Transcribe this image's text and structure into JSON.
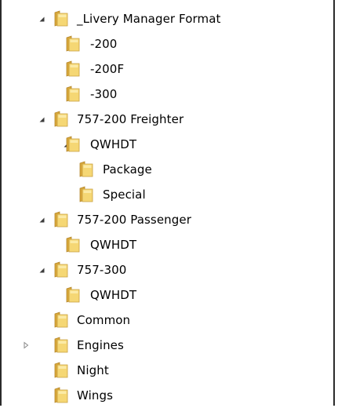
{
  "tree": {
    "items": [
      {
        "label": "_Livery Manager Format",
        "level": 0,
        "expander": "expanded"
      },
      {
        "label": "-200",
        "level": 1,
        "expander": "none"
      },
      {
        "label": "-200F",
        "level": 1,
        "expander": "none"
      },
      {
        "label": "-300",
        "level": 1,
        "expander": "none"
      },
      {
        "label": "757-200 Freighter",
        "level": 0,
        "expander": "expanded"
      },
      {
        "label": "QWHDT",
        "level": 1,
        "expander": "expanded"
      },
      {
        "label": "Package",
        "level": 2,
        "expander": "none"
      },
      {
        "label": "Special",
        "level": 2,
        "expander": "none"
      },
      {
        "label": "757-200 Passenger",
        "level": 0,
        "expander": "expanded"
      },
      {
        "label": "QWHDT",
        "level": 1,
        "expander": "none"
      },
      {
        "label": "757-300",
        "level": 0,
        "expander": "expanded"
      },
      {
        "label": "QWHDT",
        "level": 1,
        "expander": "none"
      },
      {
        "label": "Common",
        "level": 0,
        "expander": "none"
      },
      {
        "label": "Engines",
        "level": 0,
        "expander": "collapsed"
      },
      {
        "label": "Night",
        "level": 0,
        "expander": "none"
      },
      {
        "label": "Wings",
        "level": 0,
        "expander": "none"
      }
    ],
    "icons": {
      "folder": "folder-icon",
      "expanded": "triangle-down-icon",
      "collapsed": "triangle-right-icon"
    },
    "colors": {
      "folder_back": "#d9a83a",
      "folder_front": "#f5d774",
      "folder_highlight": "#fbeaa6",
      "expander_filled": "#3c3c3c",
      "expander_outline": "#8a8a8a"
    }
  }
}
